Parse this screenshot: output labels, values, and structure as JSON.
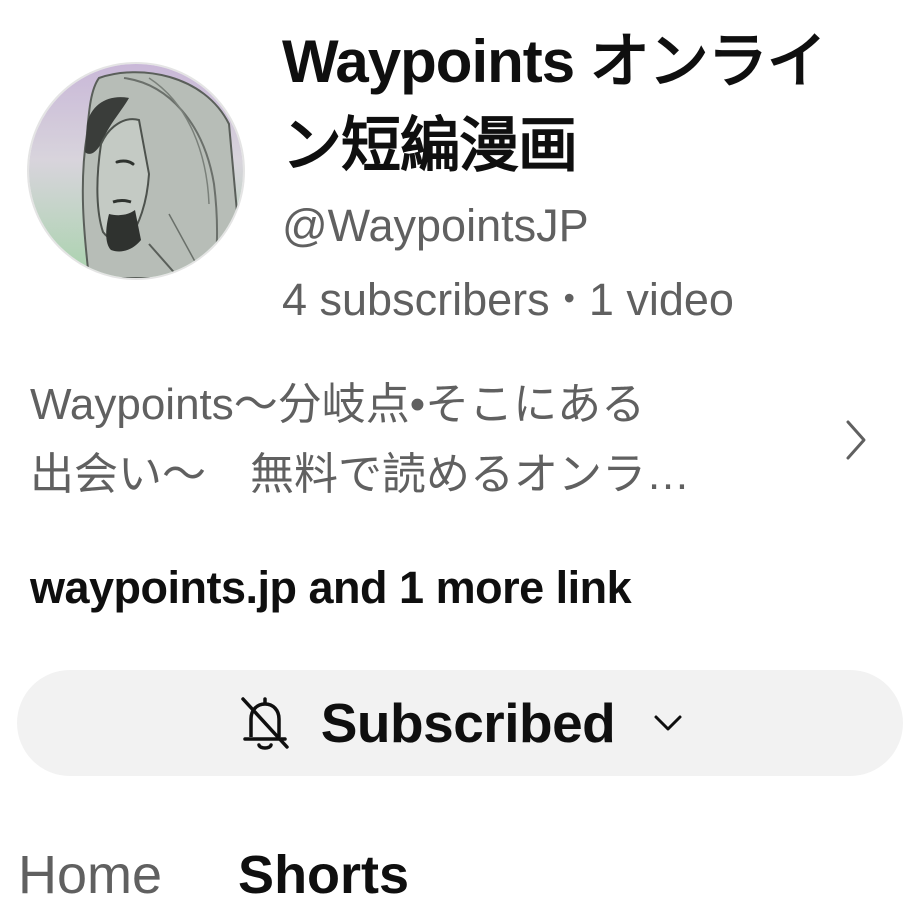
{
  "channel": {
    "title": "Waypoints オンライン短編漫画",
    "handle": "@WaypointsJP",
    "subscribers": "4 subscribers",
    "separator": "•",
    "videos": "1 video",
    "avatar_icon": "channel-avatar"
  },
  "description": {
    "line1": "Waypoints～分岐点•そこにある",
    "line2": "出会い～　無料で読めるオンラ…",
    "expand_icon": "chevron-right-icon"
  },
  "links": {
    "text": "waypoints.jp and 1 more link"
  },
  "subscribe": {
    "label": "Subscribed",
    "bell_icon": "bell-off-icon",
    "dropdown_icon": "chevron-down-icon"
  },
  "tabs": [
    {
      "label": "Home"
    },
    {
      "label": "Shorts"
    }
  ],
  "colors": {
    "primary_text": "#0f0f0f",
    "secondary_text": "#606060",
    "button_bg": "#f2f2f2"
  }
}
